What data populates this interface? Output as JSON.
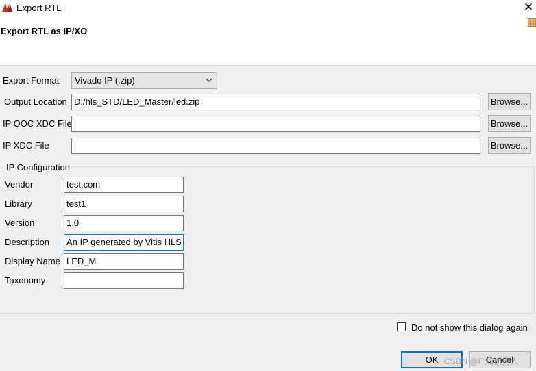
{
  "window": {
    "title": "Export RTL",
    "close_glyph": "✕"
  },
  "header": {
    "title": "Export RTL as IP/XO"
  },
  "form": {
    "export_format": {
      "label": "Export Format",
      "value": "Vivado IP (.zip)"
    },
    "output_location": {
      "label": "Output Location",
      "value": "D:/hls_STD/LED_Master/led.zip"
    },
    "ip_ooc_xdc": {
      "label": "IP OOC XDC File",
      "value": ""
    },
    "ip_xdc": {
      "label": "IP XDC File",
      "value": ""
    },
    "browse_label": "Browse..."
  },
  "ip_config": {
    "title": "IP Configuration",
    "vendor": {
      "label": "Vendor",
      "value": "test.com"
    },
    "library": {
      "label": "Library",
      "value": "test1"
    },
    "version": {
      "label": "Version",
      "value": "1.0"
    },
    "description": {
      "label": "Description",
      "value": "An IP generated by Vitis HLS"
    },
    "display_name": {
      "label": "Display Name",
      "value": "LED_M"
    },
    "taxonomy": {
      "label": "Taxonomy",
      "value": ""
    }
  },
  "footer": {
    "dont_show_label": "Do not show this dialog again",
    "dont_show_checked": false,
    "ok_label": "OK",
    "cancel_label": "Cancel",
    "watermark": "CSDN @IT知识男人"
  },
  "icons": {
    "app": "vitis-logo-icon",
    "header": "grid-icon",
    "dropdown": "chevron-down-icon"
  },
  "colors": {
    "focus": "#0078d7",
    "header_bg": "#ffffff",
    "dialog_bg": "#f0f0f0"
  }
}
